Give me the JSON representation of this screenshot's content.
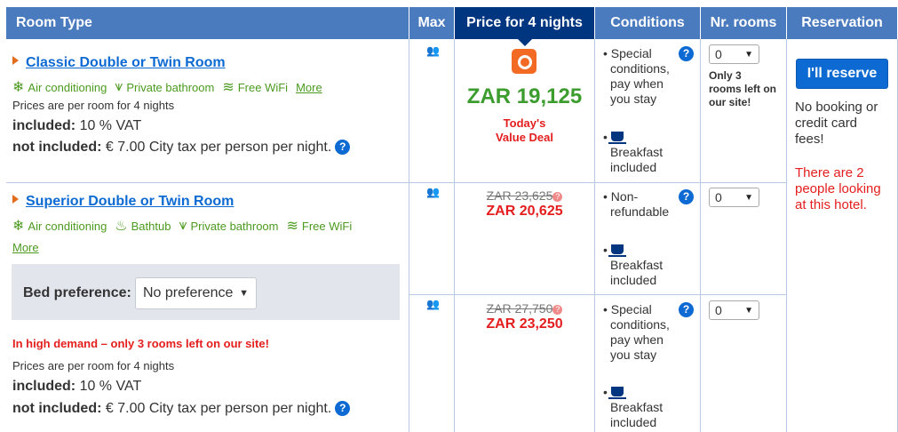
{
  "headers": {
    "room_type": "Room Type",
    "max": "Max",
    "price": "Price for 4 nights",
    "conditions": "Conditions",
    "nr_rooms": "Nr. rooms",
    "reservation": "Reservation"
  },
  "colors": {
    "header_bg": "#4a7bbf",
    "header_active": "#003580",
    "price_green": "#3c9d2e",
    "alert_red": "#e41e1e",
    "link_blue": "#0c6ad2"
  },
  "room1": {
    "name": "Classic Double or Twin Room",
    "facilities": [
      {
        "icon": "snowflake-icon",
        "label": "Air conditioning"
      },
      {
        "icon": "shower-icon",
        "label": "Private bathroom"
      },
      {
        "icon": "wifi-icon",
        "label": "Free WiFi"
      }
    ],
    "more": "More",
    "prices_note": "Prices are per room for 4 nights",
    "included_label": "included:",
    "included_value": "10 % VAT",
    "not_included_label": "not included:",
    "not_included_value": "€ 7.00 City tax per person per night.",
    "price": "ZAR 19,125",
    "deal_line1": "Today's",
    "deal_line2": "Value Deal",
    "conditions": [
      "Special",
      "conditions,",
      "pay when",
      "you stay"
    ],
    "breakfast": [
      "Breakfast",
      "included"
    ],
    "qty": "0",
    "rooms_left": [
      "Only 3",
      "rooms left on",
      "our site!"
    ]
  },
  "room2": {
    "name": "Superior Double or Twin Room",
    "facilities": [
      {
        "icon": "snowflake-icon",
        "label": "Air conditioning"
      },
      {
        "icon": "bathtub-icon",
        "label": "Bathtub"
      },
      {
        "icon": "shower-icon",
        "label": "Private bathroom"
      },
      {
        "icon": "wifi-icon",
        "label": "Free WiFi"
      }
    ],
    "more": "More",
    "bed_label": "Bed preference:",
    "bed_value": "No preference",
    "demand": "In high demand – only 3 rooms left on our site!",
    "prices_note": "Prices are per room for 4 nights",
    "included_label": "included:",
    "included_value": "10 % VAT",
    "not_included_label": "not included:",
    "not_included_value": "€ 7.00 City tax per person per night.",
    "rate_a": {
      "old_price": "ZAR 23,625",
      "price": "ZAR 20,625",
      "conditions": [
        "Non-",
        "refundable"
      ],
      "breakfast": [
        "Breakfast",
        "included"
      ],
      "qty": "0"
    },
    "rate_b": {
      "old_price": "ZAR 27,750",
      "price": "ZAR 23,250",
      "conditions": [
        "Special",
        "conditions,",
        "pay when",
        "you stay"
      ],
      "breakfast": [
        "Breakfast",
        "included"
      ],
      "qty": "0"
    }
  },
  "reservation": {
    "button": "I'll reserve",
    "no_fees": [
      "No booking or",
      "credit card",
      "fees!"
    ],
    "looking": [
      "There are 2",
      "people looking",
      "at this hotel."
    ]
  }
}
